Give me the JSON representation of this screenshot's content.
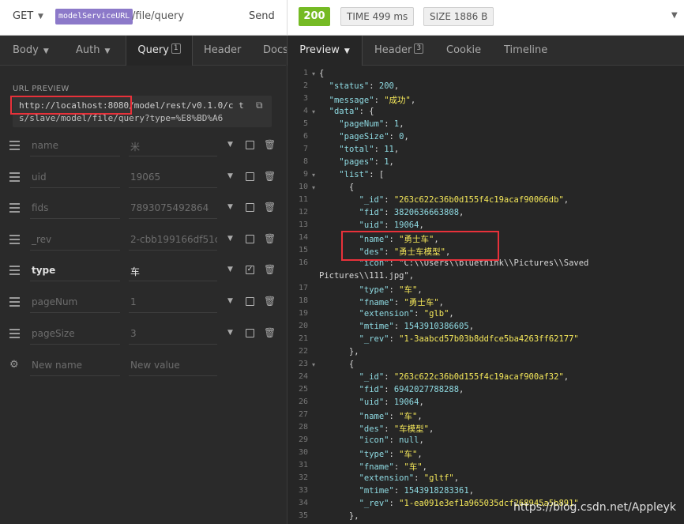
{
  "request": {
    "method": "GET",
    "env_tag": "modelServiceURL",
    "path": "/file/query",
    "send_label": "Send"
  },
  "response": {
    "status": "200",
    "time": "TIME 499 ms",
    "size": "SIZE 1886 B"
  },
  "left_tabs": [
    {
      "label": "Body"
    },
    {
      "label": "Auth"
    },
    {
      "label": "Query",
      "badge": "1"
    },
    {
      "label": "Header"
    },
    {
      "label": "Docs"
    }
  ],
  "right_tabs": [
    {
      "label": "Preview"
    },
    {
      "label": "Header",
      "badge": "3"
    },
    {
      "label": "Cookie"
    },
    {
      "label": "Timeline"
    }
  ],
  "url_preview": {
    "label": "URL PREVIEW",
    "line1_prefix": "http://localhost:8080",
    "line1_rest": "/model/rest/v0.1.0/c    t",
    "line2": "s/slave/model/file/query?type=%E8%BD%A6"
  },
  "params": [
    {
      "name": "name",
      "value": "米",
      "enabled": false
    },
    {
      "name": "uid",
      "value": "19065",
      "enabled": false
    },
    {
      "name": "fids",
      "value": "7893075492864",
      "enabled": false
    },
    {
      "name": "_rev",
      "value": "2-cbb199166df51c",
      "enabled": false
    },
    {
      "name": "type",
      "value": "车",
      "enabled": true
    },
    {
      "name": "pageNum",
      "value": "1",
      "enabled": false
    },
    {
      "name": "pageSize",
      "value": "3",
      "enabled": false
    }
  ],
  "new_param": {
    "name_placeholder": "New name",
    "value_placeholder": "New value"
  },
  "code_lines": [
    {
      "n": "1",
      "fold": "▾",
      "t": "{"
    },
    {
      "n": "2",
      "t": "  \"status\": 200,"
    },
    {
      "n": "3",
      "t": "  \"message\": \"成功\","
    },
    {
      "n": "4",
      "fold": "▾",
      "t": "  \"data\": {"
    },
    {
      "n": "5",
      "t": "    \"pageNum\": 1,"
    },
    {
      "n": "6",
      "t": "    \"pageSize\": 0,"
    },
    {
      "n": "7",
      "t": "    \"total\": 11,"
    },
    {
      "n": "8",
      "t": "    \"pages\": 1,"
    },
    {
      "n": "9",
      "fold": "▾",
      "t": "    \"list\": ["
    },
    {
      "n": "10",
      "fold": "▾",
      "t": "      {"
    },
    {
      "n": "11",
      "t": "        \"_id\": \"263c622c36b0d155f4c19acaf90066db\","
    },
    {
      "n": "12",
      "t": "        \"fid\": 3820636663808,"
    },
    {
      "n": "13",
      "t": "        \"uid\": 19064,"
    },
    {
      "n": "14",
      "t": "        \"name\": \"勇士车\","
    },
    {
      "n": "15",
      "t": "        \"des\": \"勇士车模型\","
    },
    {
      "n": "16",
      "t": "        \"icon\": \"C:\\\\Users\\\\bluethink\\\\Pictures\\\\Saved"
    },
    {
      "n": "",
      "t": "Pictures\\\\111.jpg\","
    },
    {
      "n": "17",
      "t": "        \"type\": \"车\","
    },
    {
      "n": "18",
      "t": "        \"fname\": \"勇士车\","
    },
    {
      "n": "19",
      "t": "        \"extension\": \"glb\","
    },
    {
      "n": "20",
      "t": "        \"mtime\": 1543910386605,"
    },
    {
      "n": "21",
      "t": "        \"_rev\": \"1-3aabcd57b03b8ddfce5ba4263ff62177\""
    },
    {
      "n": "22",
      "t": "      },"
    },
    {
      "n": "23",
      "fold": "▾",
      "t": "      {"
    },
    {
      "n": "24",
      "t": "        \"_id\": \"263c622c36b0d155f4c19acaf900af32\","
    },
    {
      "n": "25",
      "t": "        \"fid\": 6942027788288,"
    },
    {
      "n": "26",
      "t": "        \"uid\": 19064,"
    },
    {
      "n": "27",
      "t": "        \"name\": \"车\","
    },
    {
      "n": "28",
      "t": "        \"des\": \"车模型\","
    },
    {
      "n": "29",
      "t": "        \"icon\": null,"
    },
    {
      "n": "30",
      "t": "        \"type\": \"车\","
    },
    {
      "n": "31",
      "t": "        \"fname\": \"车\","
    },
    {
      "n": "32",
      "t": "        \"extension\": \"gltf\","
    },
    {
      "n": "33",
      "t": "        \"mtime\": 1543918283361,"
    },
    {
      "n": "34",
      "t": "        \"_rev\": \"1-ea091e3ef1a965035dcf268945a5b891\""
    },
    {
      "n": "35",
      "t": "      },"
    }
  ],
  "watermark": "https://blog.csdn.net/Appleyk"
}
